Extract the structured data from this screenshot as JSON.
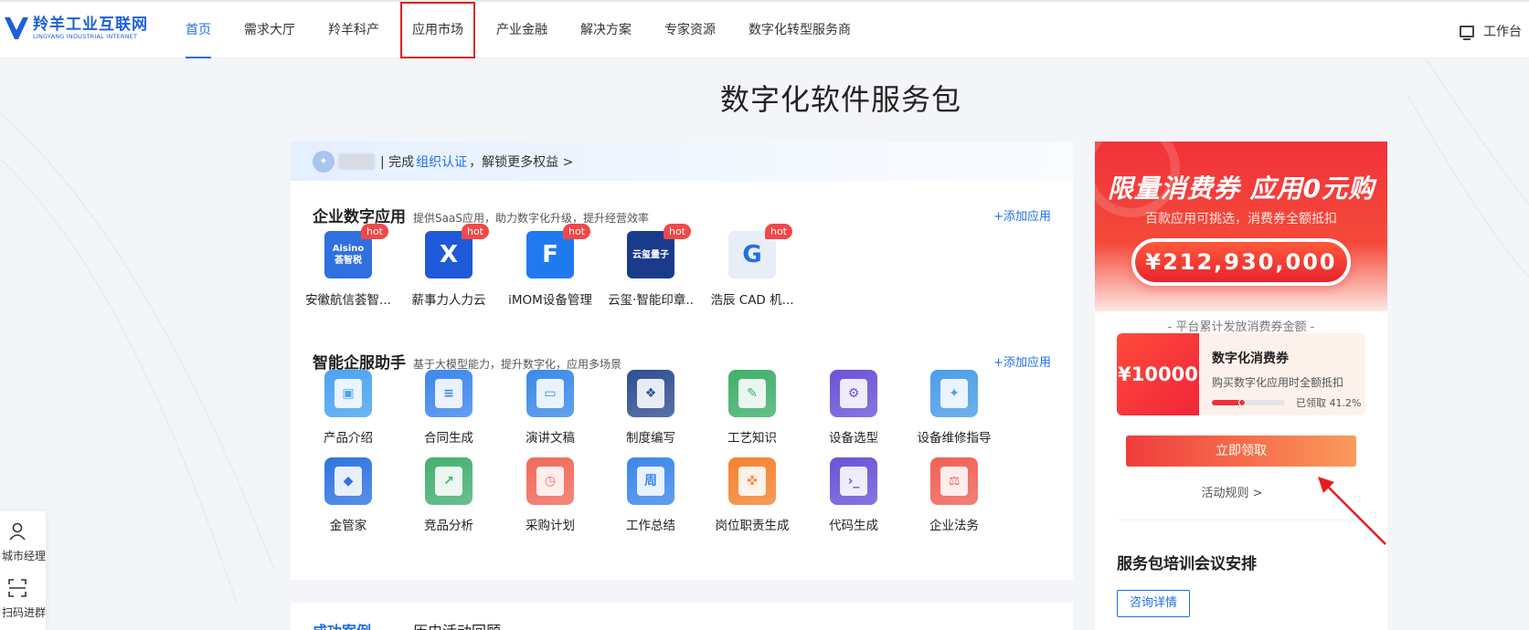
{
  "header": {
    "logo_cn": "羚羊工业互联网",
    "logo_en": "LINGYANG INDUSTRIAL INTERNET",
    "nav": [
      "首页",
      "需求大厅",
      "羚羊科产",
      "应用市场",
      "产业金融",
      "解决方案",
      "专家资源",
      "数字化转型服务商"
    ],
    "active_index": 0,
    "highlight_index": 3,
    "workbench": "工作台"
  },
  "page_title": "数字化软件服务包",
  "cert_bar": {
    "prefix": "| 完成",
    "link": "组织认证",
    "suffix": "，解锁更多权益 >"
  },
  "enterprise_apps": {
    "title": "企业数字应用",
    "subtitle": "提供SaaS应用，助力数字化升级，提升经营效率",
    "add_label": "+添加应用",
    "badge": "hot",
    "items": [
      {
        "name": "安徽航信荟智...",
        "icon": "aisino-icon",
        "icon_text": "Aisino\n荟智税",
        "color": "#2f6fe0"
      },
      {
        "name": "薪事力人力云",
        "icon": "xinshili-icon",
        "icon_text": "X",
        "color": "#1e5ad8"
      },
      {
        "name": "iMOM设备管理",
        "icon": "imom-icon",
        "icon_text": "F",
        "color": "#1f7af0"
      },
      {
        "name": "云玺·智能印章..",
        "icon": "yunxi-icon",
        "icon_text": "云玺量子",
        "color": "#1a3b8c"
      },
      {
        "name": "浩辰 CAD 机...",
        "icon": "gstarcad-icon",
        "icon_text": "G",
        "color": "#e8eef8"
      }
    ]
  },
  "assistant": {
    "title": "智能企服助手",
    "subtitle": "基于大模型能力，提升数字化，应用多场景",
    "add_label": "+添加应用",
    "items": [
      {
        "name": "产品介绍",
        "icon": "product-intro-icon",
        "color": "#4aa3f0"
      },
      {
        "name": "合同生成",
        "icon": "contract-icon",
        "color": "#3d86ec"
      },
      {
        "name": "演讲文稿",
        "icon": "speech-icon",
        "color": "#3b8ae8"
      },
      {
        "name": "制度编写",
        "icon": "policy-book-icon",
        "color": "#2f4f93"
      },
      {
        "name": "工艺知识",
        "icon": "craft-knowledge-icon",
        "color": "#3fb06a"
      },
      {
        "name": "设备选型",
        "icon": "device-selection-icon",
        "color": "#6b52d8"
      },
      {
        "name": "设备维修指导",
        "icon": "device-repair-icon",
        "color": "#4b9de8"
      },
      {
        "name": "金管家",
        "icon": "finance-butler-icon",
        "color": "#2e74e0"
      },
      {
        "name": "竞品分析",
        "icon": "competitor-analysis-icon",
        "color": "#44b070"
      },
      {
        "name": "采购计划",
        "icon": "purchase-plan-icon",
        "color": "#f06a5a"
      },
      {
        "name": "工作总结",
        "icon": "work-summary-icon",
        "color": "#3b86ea"
      },
      {
        "name": "岗位职责生成",
        "icon": "job-duty-icon",
        "color": "#f5822f"
      },
      {
        "name": "代码生成",
        "icon": "code-gen-icon",
        "color": "#6a52d8"
      },
      {
        "name": "企业法务",
        "icon": "legal-icon",
        "color": "#f06055"
      }
    ]
  },
  "bottom_tabs": [
    "成功案例",
    "历史活动回顾"
  ],
  "promo": {
    "title": "限量消费券 应用0元购",
    "subtitle": "百款应用可挑选，消费券全额抵扣",
    "amount": "¥212,930,000",
    "caption": "- 平台累计发放消费券金额 -"
  },
  "coupon": {
    "value": "¥10000",
    "title": "数字化消费券",
    "desc": "购买数字化应用时全额抵扣",
    "claimed_label": "已领取 41.2%",
    "claimed_fraction": 0.412
  },
  "claim_button": "立即领取",
  "rules_link": "活动规则 >",
  "meeting_title": "服务包培训会议安排",
  "consult_button": "咨询详情",
  "float_bar": [
    "城市经理",
    "扫码进群"
  ],
  "colors": {
    "primary": "#1f6fe6",
    "accent_red": "#f0303a",
    "highlight_box": "#e02020"
  }
}
